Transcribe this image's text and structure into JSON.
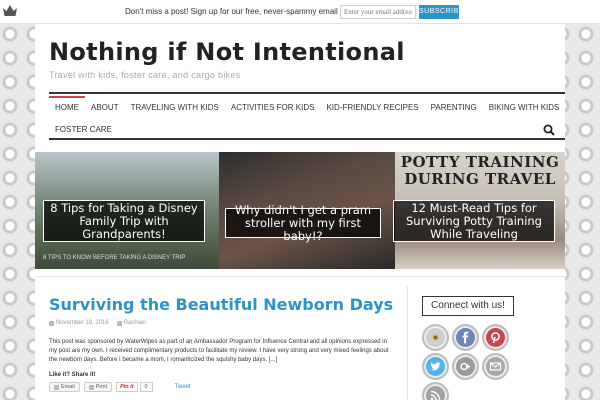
{
  "topbar": {
    "message": "Don't miss a post! Sign up for our free, never-spammy email updates.",
    "email_placeholder": "Enter your email address",
    "subscribe_label": "SUBSCRIBE"
  },
  "site": {
    "title": "Nothing if Not Intentional",
    "tagline": "Travel with kids, foster care, and cargo bikes"
  },
  "nav": {
    "row1": [
      "HOME",
      "ABOUT",
      "TRAVELING WITH KIDS",
      "ACTIVITIES FOR KIDS",
      "KID-FRIENDLY RECIPES",
      "PARENTING",
      "BIKING WITH KIDS"
    ],
    "row2": [
      "FOSTER CARE"
    ],
    "active": "HOME",
    "accent_colors": [
      "#d74444",
      "#f0a23a",
      "#2b93c7",
      "#8bc34a",
      "#f0a23a",
      "#9b59b6",
      "#2b93c7",
      "#f0a23a"
    ]
  },
  "slider": {
    "slide1_title": "8 Tips for Taking a Disney Family Trip with Grandparents!",
    "slide1_caption": "8 TIPS TO KNOW BEFORE TAKING A DISNEY TRIP",
    "slide2_title": "Why didn't I get a pram stroller with my first baby!?",
    "slide3_image_text": "POTTY TRAINING DURING TRAVEL",
    "slide3_title": "12 Must-Read Tips for Surviving Potty Training While Traveling"
  },
  "post": {
    "title": "Surviving the Beautiful Newborn Days",
    "date": "November 18, 2016",
    "author": "Rachael",
    "excerpt": "This post was sponsored by WaterWipes as part of an Ambassador Program for Influence Central and all opinions expressed in my post are my own. I received complimentary products to facilitate my review.  I have very strong and very mixed feelings about the newborn days. Before I became a mom, I romanticized the squishy baby days. [...]",
    "like_share": "Like it? Share it!",
    "email_btn": "Email",
    "print_btn": "Print",
    "pin_label": "Pin it",
    "pin_count": "0",
    "tweet_label": "Tweet"
  },
  "sidebar": {
    "connect_title": "Connect with us!",
    "social_icons": [
      "sunflower-icon",
      "facebook-icon",
      "pinterest-icon",
      "twitter-icon",
      "google-plus-icon",
      "email-icon",
      "rss-icon"
    ]
  },
  "colors": {
    "accent_blue": "#2b93c7",
    "title_dark": "#222222",
    "pinterest_red": "#cb2027"
  }
}
